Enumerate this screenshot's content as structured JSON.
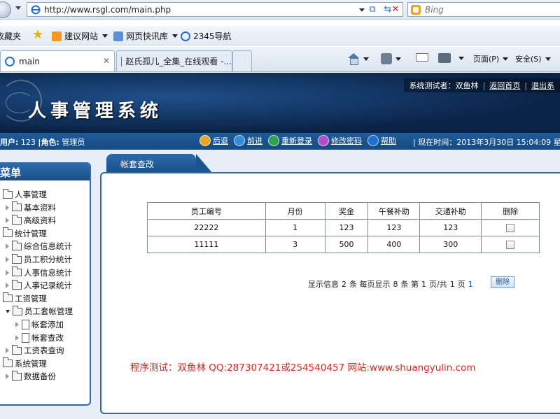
{
  "browser": {
    "url": "http://www.rsgl.com/main.php",
    "search_engine": "Bing",
    "favorites": {
      "label": "收藏夹",
      "items": [
        "建议网站",
        "网页快讯库",
        "2345导航"
      ]
    },
    "tabs": [
      {
        "title": "main",
        "active": true
      },
      {
        "title": "赵氏孤儿_全集_在线观看 -...",
        "active": false
      }
    ],
    "commands": {
      "page": "页面(P)",
      "safety": "安全(S)"
    }
  },
  "app": {
    "title": "人事管理系统",
    "tester_label": "系统测试者：双鱼林",
    "back_home": "返回首页",
    "logout": "退出系",
    "user_label": "用户:",
    "user_value": "123",
    "role_label": "角色:",
    "role_value": "管理员",
    "actions": [
      "后退",
      "前进",
      "重新登录",
      "修改密码",
      "帮助"
    ],
    "time_label": "现在时间：2013年3月30日 15:04:09 星期"
  },
  "sidebar": {
    "header": "菜单",
    "tree": [
      {
        "label": "人事管理",
        "level": 0,
        "type": "folder",
        "open": true
      },
      {
        "label": "基本资料",
        "level": 1,
        "type": "folder",
        "open": false
      },
      {
        "label": "高级资料",
        "level": 1,
        "type": "folder",
        "open": false
      },
      {
        "label": "统计管理",
        "level": 0,
        "type": "folder",
        "open": true
      },
      {
        "label": "综合信息统计",
        "level": 1,
        "type": "folder",
        "open": false
      },
      {
        "label": "员工积分统计",
        "level": 1,
        "type": "folder",
        "open": false
      },
      {
        "label": "人事信息统计",
        "level": 1,
        "type": "folder",
        "open": false
      },
      {
        "label": "人事记录统计",
        "level": 1,
        "type": "folder",
        "open": false
      },
      {
        "label": "工资管理",
        "level": 0,
        "type": "folder",
        "open": true
      },
      {
        "label": "员工套帐管理",
        "level": 1,
        "type": "folder",
        "open": true
      },
      {
        "label": "帐套添加",
        "level": 2,
        "type": "page"
      },
      {
        "label": "帐套查改",
        "level": 2,
        "type": "page"
      },
      {
        "label": "工资表查询",
        "level": 1,
        "type": "folder",
        "open": false
      },
      {
        "label": "系统管理",
        "level": 0,
        "type": "folder",
        "open": true
      },
      {
        "label": "数据备份",
        "level": 1,
        "type": "folder",
        "open": false
      }
    ]
  },
  "content": {
    "tab": "帐套查改",
    "table": {
      "headers": [
        "员工编号",
        "月份",
        "奖金",
        "午餐补助",
        "交通补助",
        "删除"
      ],
      "rows": [
        [
          "22222",
          "1",
          "123",
          "123",
          "123"
        ],
        [
          "11111",
          "3",
          "500",
          "400",
          "300"
        ]
      ]
    },
    "pager": {
      "a": "显示信息",
      "total": "2",
      "b": "条 每页显示",
      "per": "8",
      "c": "条 第",
      "cur": "1",
      "d": "页/共",
      "pages": "1",
      "e": "页",
      "link": "1"
    },
    "delete_button": "删除",
    "footer": "程序测试：双鱼林 QQ:287307421或254540457 网站:www.shuangyulin.com"
  }
}
